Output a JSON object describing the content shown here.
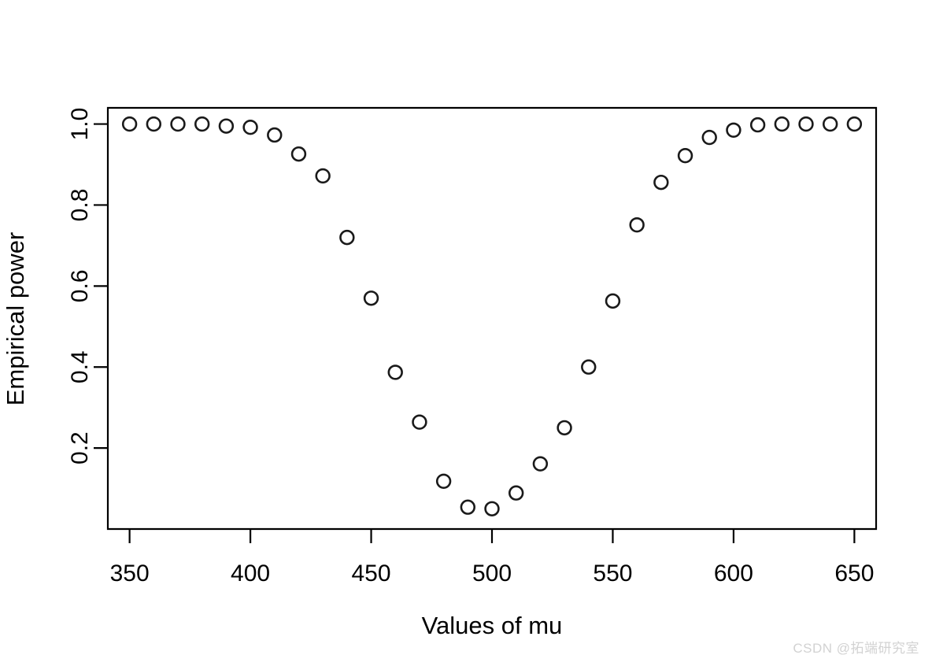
{
  "figure": {
    "background_color": "#ffffff",
    "foreground_color": "#000000",
    "marker_symbol": "open-circle",
    "watermark": "CSDN @拓端研究室"
  },
  "chart_data": {
    "type": "scatter",
    "title": "",
    "xlabel": "Values of mu",
    "ylabel": "Empirical power",
    "xlim": [
      341,
      659
    ],
    "ylim": [
      0.0,
      1.04
    ],
    "grid": false,
    "legend": null,
    "x_ticks": [
      350,
      400,
      450,
      500,
      550,
      600,
      650
    ],
    "x_tick_labels": [
      "350",
      "400",
      "450",
      "500",
      "550",
      "600",
      "650"
    ],
    "y_ticks": [
      0.2,
      0.4,
      0.6,
      0.8,
      1.0
    ],
    "y_tick_labels": [
      "0.2",
      "0.4",
      "0.6",
      "0.8",
      "1.0"
    ],
    "x": [
      350,
      360,
      370,
      380,
      390,
      400,
      410,
      420,
      430,
      440,
      450,
      460,
      470,
      480,
      490,
      500,
      510,
      520,
      530,
      540,
      550,
      560,
      570,
      580,
      590,
      600,
      610,
      620,
      630,
      640,
      650
    ],
    "values": [
      1.0,
      1.0,
      1.0,
      1.0,
      0.995,
      0.992,
      0.973,
      0.926,
      0.872,
      0.72,
      0.57,
      0.387,
      0.264,
      0.118,
      0.054,
      0.05,
      0.089,
      0.161,
      0.25,
      0.4,
      0.563,
      0.751,
      0.856,
      0.922,
      0.967,
      0.985,
      0.998,
      1.0,
      1.0,
      1.0,
      1.0
    ]
  }
}
